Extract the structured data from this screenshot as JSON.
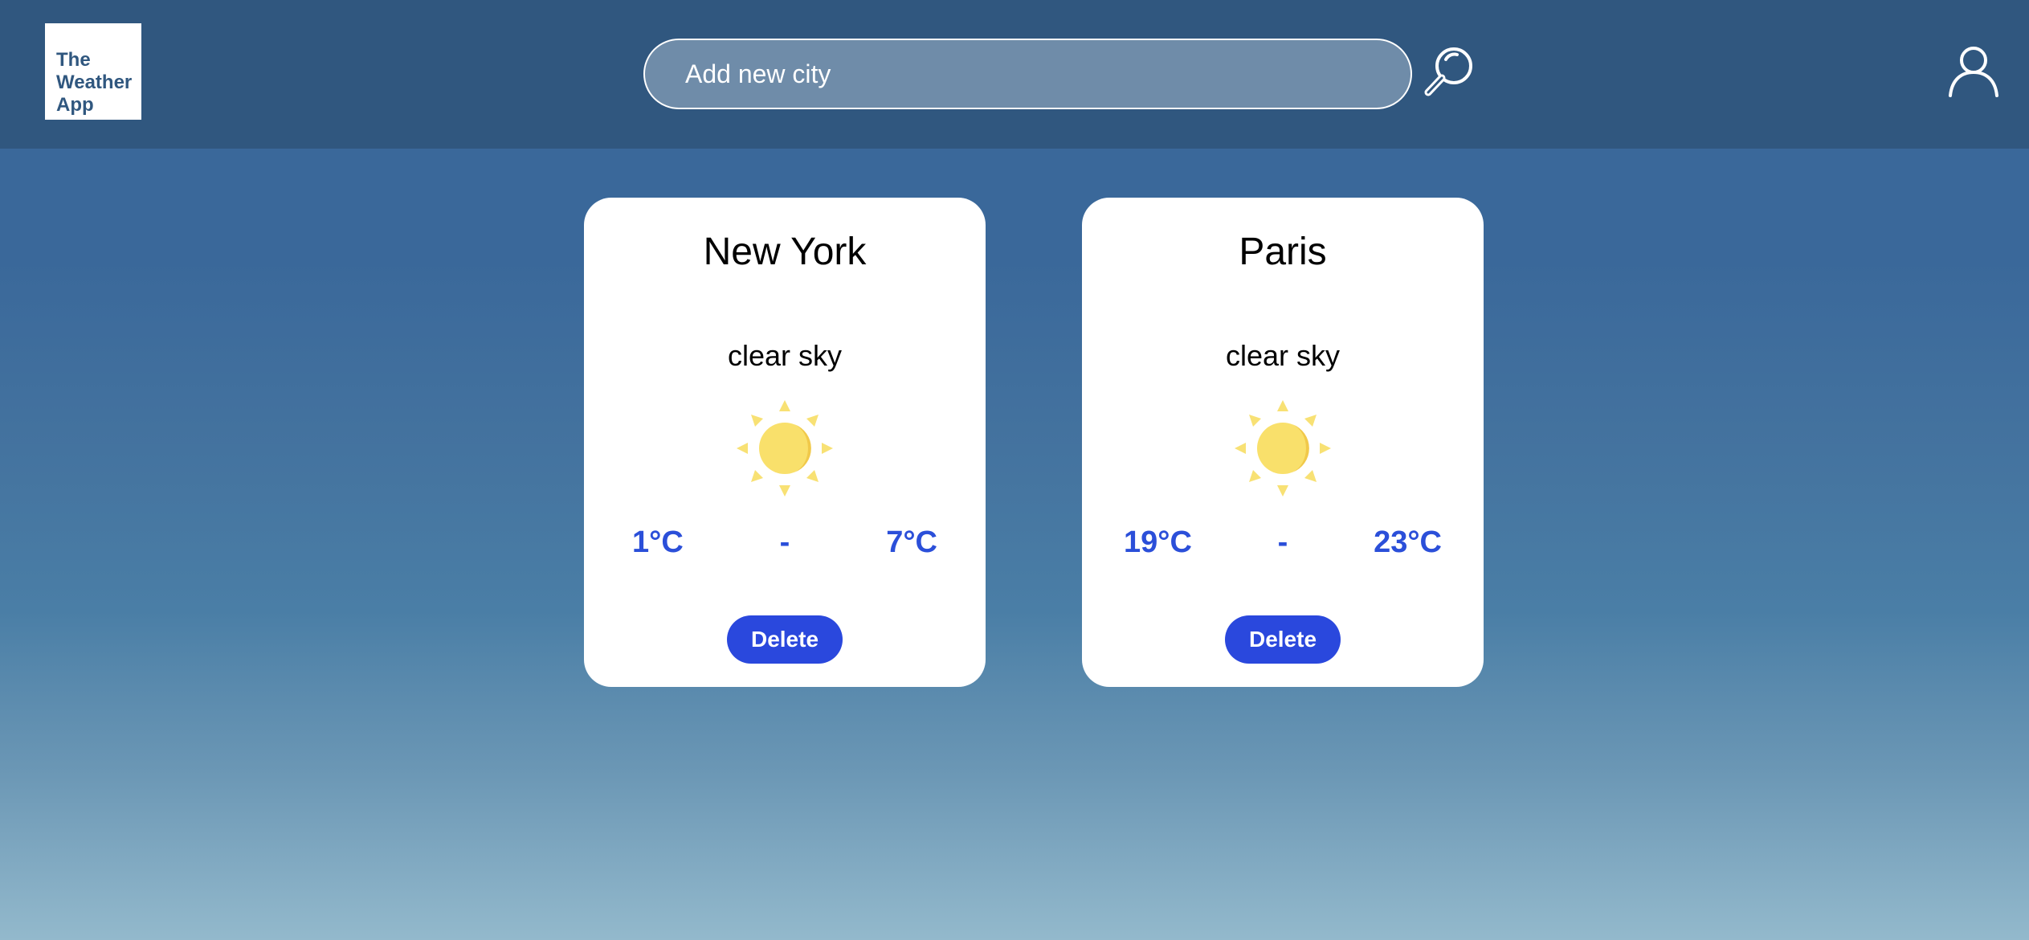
{
  "header": {
    "logo_lines": [
      "The",
      "Weather",
      "App"
    ],
    "search": {
      "placeholder": "Add new city",
      "value": ""
    },
    "search_icon": "magnifier-icon",
    "user_icon": "user-icon"
  },
  "cities": [
    {
      "name": "New York",
      "description": "clear sky",
      "icon": "sun-icon",
      "min": "1°C",
      "separator": "-",
      "max": "7°C",
      "delete_label": "Delete"
    },
    {
      "name": "Paris",
      "description": "clear sky",
      "icon": "sun-icon",
      "min": "19°C",
      "separator": "-",
      "max": "23°C",
      "delete_label": "Delete"
    }
  ],
  "colors": {
    "header_bg": "#30577f",
    "temperature": "#2b4fd9",
    "button": "#2a48dd",
    "sun": "#f8e174"
  }
}
